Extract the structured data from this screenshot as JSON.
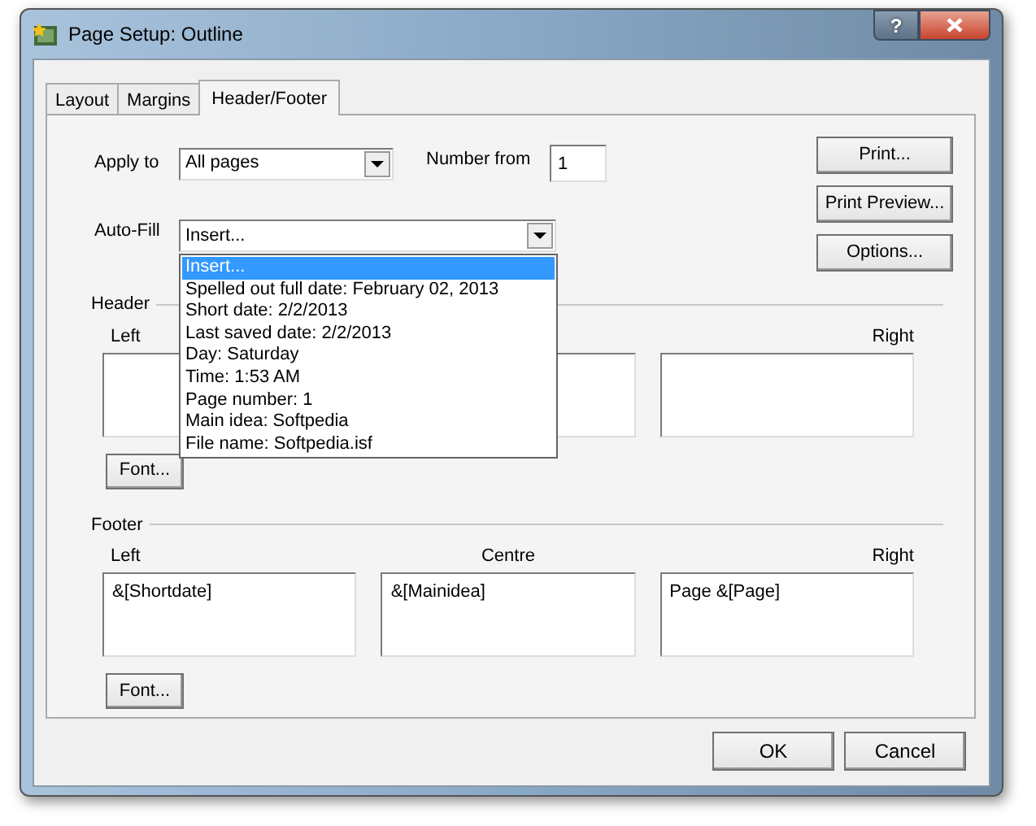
{
  "window": {
    "title": "Page Setup: Outline",
    "help_button": "?"
  },
  "tabs": [
    {
      "label": "Layout",
      "selected": false
    },
    {
      "label": "Margins",
      "selected": false
    },
    {
      "label": "Header/Footer",
      "selected": true
    }
  ],
  "apply_to": {
    "label": "Apply to",
    "value": "All pages"
  },
  "number_from": {
    "label": "Number from",
    "value": "1"
  },
  "auto_fill": {
    "label": "Auto-Fill",
    "value": "Insert...",
    "expanded": true,
    "options": [
      {
        "label": "Insert...",
        "selected": true
      },
      {
        "label": "Spelled out full date: February 02, 2013",
        "selected": false
      },
      {
        "label": "Short date: 2/2/2013",
        "selected": false
      },
      {
        "label": "Last saved date: 2/2/2013",
        "selected": false
      },
      {
        "label": "Day: Saturday",
        "selected": false
      },
      {
        "label": "Time: 1:53 AM",
        "selected": false
      },
      {
        "label": "Page number: 1",
        "selected": false
      },
      {
        "label": "Main idea: Softpedia",
        "selected": false
      },
      {
        "label": "File name: Softpedia.isf",
        "selected": false
      }
    ]
  },
  "side_buttons": [
    "Print...",
    "Print Preview...",
    "Options..."
  ],
  "header": {
    "title": "Header",
    "columns": [
      {
        "label": "Left"
      },
      {},
      {
        "label": "Right"
      }
    ],
    "font_button": "Font..."
  },
  "footer": {
    "title": "Footer",
    "columns": [
      {
        "label": "Left",
        "text": "&[Shortdate]"
      },
      {
        "label": "Centre",
        "text": "&[Mainidea]"
      },
      {
        "label": "Right",
        "text": "Page &[Page]"
      }
    ],
    "font_button": "Font..."
  },
  "buttons": [
    "OK",
    "Cancel"
  ]
}
